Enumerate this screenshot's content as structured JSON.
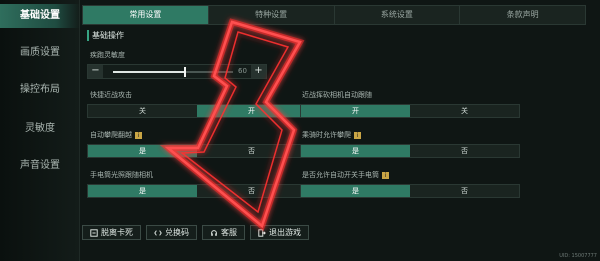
{
  "sidebar": {
    "items": [
      {
        "label": "基础设置",
        "active": true
      },
      {
        "label": "画质设置",
        "active": false
      },
      {
        "label": "操控布局",
        "active": false
      },
      {
        "label": "灵敏度",
        "active": false
      },
      {
        "label": "声音设置",
        "active": false
      }
    ]
  },
  "tabs": [
    {
      "label": "常用设置",
      "active": true
    },
    {
      "label": "特种设置",
      "active": false
    },
    {
      "label": "系统设置",
      "active": false
    },
    {
      "label": "条款声明",
      "active": false
    }
  ],
  "section": {
    "title": "基础操作"
  },
  "slider": {
    "label": "疾跑灵敏度",
    "minus": "−",
    "plus": "+",
    "value": "60",
    "level": 0.6
  },
  "settings": {
    "quick_melee": {
      "label": "快捷近战攻击",
      "options": [
        "关",
        "开"
      ],
      "selected": 1
    },
    "melee_camera": {
      "label": "近战挥砍相机自动跟随",
      "options": [
        "开",
        "关"
      ],
      "selected": 0
    },
    "auto_climb": {
      "label": "自动攀爬翻越",
      "options": [
        "是",
        "否"
      ],
      "selected": 0
    },
    "climb_on_ride": {
      "label": "乘骑时允许攀爬",
      "options": [
        "是",
        "否"
      ],
      "selected": 0
    },
    "flashlight_camera": {
      "label": "手电筒光照跟随相机",
      "options": [
        "是",
        "否"
      ],
      "selected": 0
    },
    "flashlight_auto": {
      "label": "是否允许自动开关手电筒",
      "options": [
        "是",
        "否"
      ],
      "selected": 0
    }
  },
  "bottom": {
    "unstuck": "脱离卡死",
    "redeem": "兑换码",
    "support": "客服",
    "exit": "退出游戏"
  },
  "uid": "UID: 15007777",
  "colors": {
    "accent": "#2f7a64",
    "arrow": "#ff2a2a",
    "badge": "#c9a545"
  }
}
